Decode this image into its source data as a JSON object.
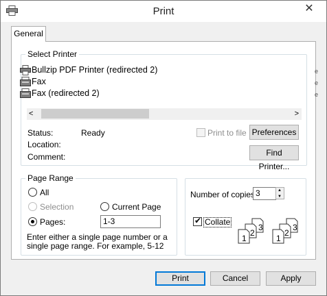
{
  "window": {
    "title": "Print",
    "close_glyph": "✕"
  },
  "tabs": [
    {
      "label": "General"
    }
  ],
  "select_printer": {
    "legend": "Select Printer",
    "printers": [
      {
        "name": "Bullzip PDF Printer (redirected 2)",
        "icon": "printer-icon"
      },
      {
        "name": "Fax",
        "icon": "fax-icon"
      },
      {
        "name": "Fax (redirected 2)",
        "icon": "fax-icon"
      }
    ],
    "overflow_mark": "e",
    "scroll_left": "<",
    "scroll_right": ">",
    "status_label": "Status:",
    "status_value": "Ready",
    "location_label": "Location:",
    "location_value": "",
    "comment_label": "Comment:",
    "comment_value": "",
    "print_to_file_label": "Print to file",
    "print_to_file_checked": false,
    "preferences_label": "Preferences",
    "find_printer_label": "Find Printer..."
  },
  "page_range": {
    "legend": "Page Range",
    "all_label": "All",
    "selection_label": "Selection",
    "current_page_label": "Current Page",
    "pages_label": "Pages:",
    "selected": "pages",
    "pages_value": "1-3",
    "hint": "Enter either a single page number or a single page range.  For example, 5-12"
  },
  "copies": {
    "label": "Number of copies:",
    "value": "3",
    "collate_label": "Collate",
    "collate_checked": true,
    "collate_pages": [
      "1",
      "2",
      "3",
      "1",
      "2",
      "3"
    ]
  },
  "footer": {
    "print_label": "Print",
    "cancel_label": "Cancel",
    "apply_label": "Apply"
  },
  "colors": {
    "accent": "#0078d7",
    "panel_bg": "#ffffff",
    "dialog_bg": "#f0f0f0"
  }
}
